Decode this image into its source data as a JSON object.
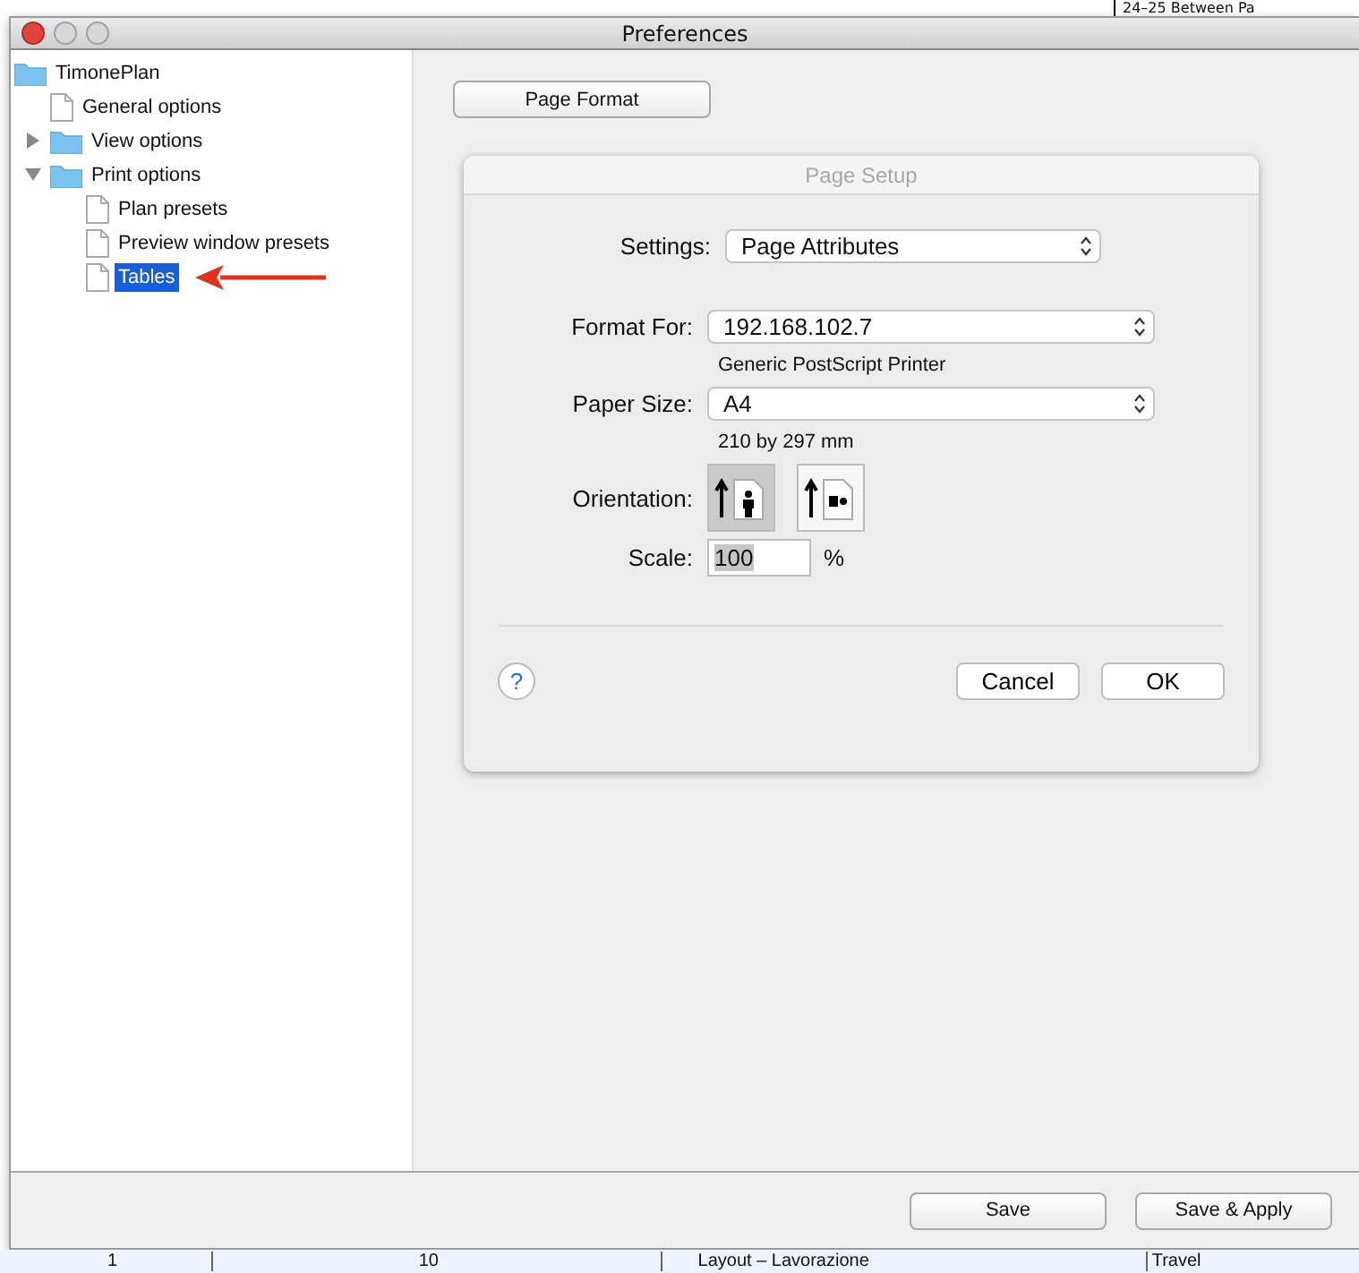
{
  "background_app": {
    "top_text": "24–25  Between Pa",
    "bottom_cells": [
      "1",
      "10",
      "Layout – Lavorazione",
      "Travel"
    ]
  },
  "window": {
    "title": "Preferences"
  },
  "tree": [
    {
      "label": "TimonePlan",
      "kind": "folder",
      "selected": false,
      "children": [
        {
          "label": "General options",
          "kind": "document",
          "selected": false
        },
        {
          "label": "View options",
          "kind": "folder",
          "expanded": false,
          "selected": false
        },
        {
          "label": "Print options",
          "kind": "folder",
          "expanded": true,
          "selected": false,
          "children": [
            {
              "label": "Plan presets",
              "kind": "document",
              "selected": false
            },
            {
              "label": "Preview window presets",
              "kind": "document",
              "selected": false
            },
            {
              "label": "Tables",
              "kind": "document",
              "selected": true,
              "pointer": true
            }
          ]
        }
      ]
    }
  ],
  "page_format_button": "Page Format",
  "page_setup": {
    "title": "Page Setup",
    "settings": {
      "label": "Settings:",
      "value": "Page Attributes"
    },
    "format_for": {
      "label": "Format For:",
      "value": "192.168.102.7",
      "note": "Generic PostScript Printer"
    },
    "paper_size": {
      "label": "Paper Size:",
      "value": "A4",
      "note": "210 by 297 mm"
    },
    "orientation": {
      "label": "Orientation:",
      "options": [
        {
          "kind": "portrait",
          "selected": true
        },
        {
          "kind": "landscape",
          "selected": false
        }
      ]
    },
    "scale": {
      "label": "Scale:",
      "value": "100",
      "unit": "%"
    },
    "help": "?",
    "buttons": [
      "Cancel",
      "OK"
    ]
  },
  "footer_buttons": [
    "Save",
    "Save & Apply"
  ]
}
